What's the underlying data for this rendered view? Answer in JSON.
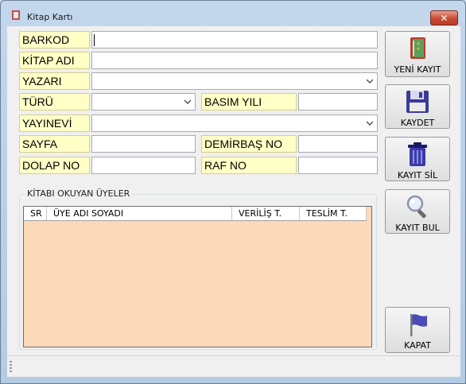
{
  "window": {
    "title": "Kitap Kartı"
  },
  "form": {
    "barkod_label": "BARKOD",
    "kitap_adi_label": "KİTAP ADI",
    "yazari_label": "YAZARI",
    "turu_label": "TÜRÜ",
    "basim_yili_label": "BASIM YILI",
    "yayinevi_label": "YAYINEVİ",
    "sayfa_label": "SAYFA",
    "demirbas_label": "DEMİRBAŞ NO",
    "dolap_label": "DOLAP NO",
    "raf_label": "RAF NO",
    "barkod_value": "",
    "kitap_adi_value": "",
    "yazari_value": "",
    "turu_value": "",
    "basim_yili_value": "",
    "yayinevi_value": "",
    "sayfa_value": "",
    "demirbas_value": "",
    "dolap_value": "",
    "raf_value": ""
  },
  "buttons": {
    "yeni_kayit": "YENİ KAYIT",
    "kaydet": "KAYDET",
    "kayit_sil": "KAYIT SİL",
    "kayit_bul": "KAYIT BUL",
    "kapat": "KAPAT"
  },
  "readers": {
    "title": "KİTABI OKUYAN ÜYELER",
    "columns": [
      "SR",
      "ÜYE ADI SOYADI",
      "VERİLİŞ T.",
      "TESLİM T."
    ],
    "rows": []
  },
  "colors": {
    "label_bg": "#ffffc6",
    "grid_bg": "#fcd9b8",
    "close_button": "#c84b35"
  }
}
